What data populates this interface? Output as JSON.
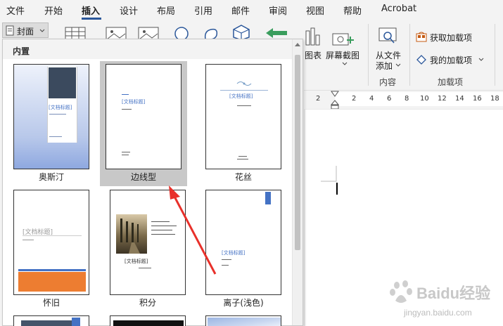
{
  "menu": [
    "文件",
    "开始",
    "插入",
    "设计",
    "布局",
    "引用",
    "邮件",
    "审阅",
    "视图",
    "帮助",
    "Acrobat"
  ],
  "active_tab": "插入",
  "ribbon": {
    "cover_label": "封面",
    "chart_label": "图表",
    "screenshot_label": "屏幕截图",
    "from_file_l1": "从文件",
    "from_file_l2": "添加",
    "content_group": "内容",
    "get_addins": "获取加载项",
    "my_addins": "我的加载项",
    "addins_group": "加载项"
  },
  "ruler_ticks": [
    "2",
    "2",
    "4",
    "6",
    "8",
    "10",
    "12",
    "14",
    "16",
    "18"
  ],
  "dropdown": {
    "section_title": "内置",
    "templates": [
      {
        "name": "奥斯汀",
        "title": "[文档标题]"
      },
      {
        "name": "边线型",
        "title": "[文档标题]"
      },
      {
        "name": "花丝",
        "title": "[文档标题]"
      },
      {
        "name": "怀旧",
        "title": "[文档标题]"
      },
      {
        "name": "积分",
        "title": "[文档标题]"
      },
      {
        "name": "离子(浅色)",
        "title": "[文档标题]"
      }
    ],
    "selected": "边线型"
  },
  "watermark": {
    "brand": "Baidu经验",
    "url": "jingyan.baidu.com"
  },
  "colors": {
    "accent": "#2b579a",
    "arrow": "#e8302a",
    "selection": "#c8c8c8"
  }
}
